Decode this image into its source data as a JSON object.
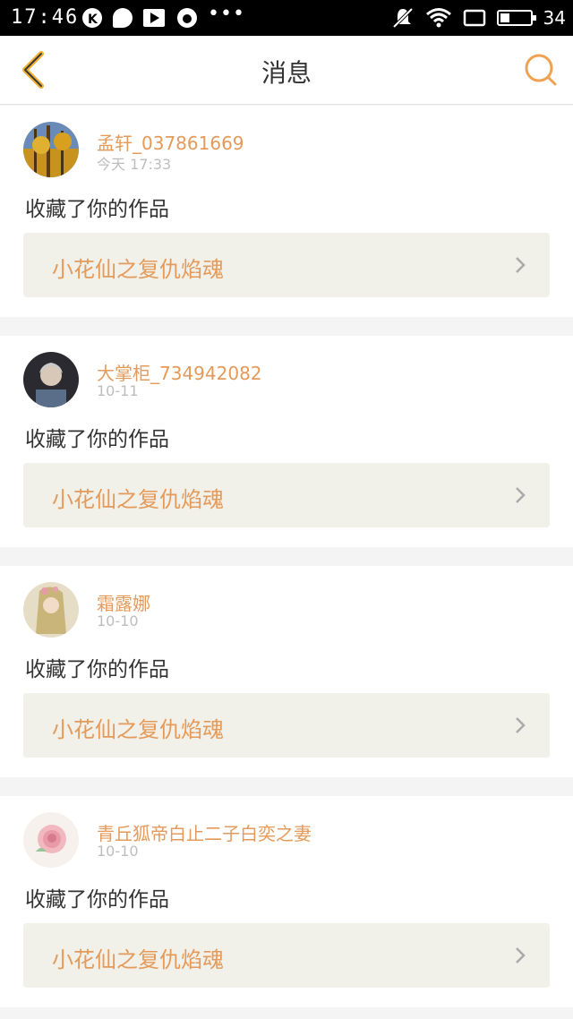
{
  "status_bar": {
    "time": "17:46",
    "battery_level": "34",
    "battery_fraction": 0.34,
    "icons": [
      "k-badge-icon",
      "chat-bubble-icon",
      "video-play-icon",
      "app-icon",
      "more-dots-icon",
      "mute-bell-icon",
      "wifi-icon",
      "screen-rotate-icon",
      "battery-icon"
    ]
  },
  "header": {
    "title": "消息",
    "back_icon": "chevron-left-icon",
    "search_icon": "search-icon",
    "accent_color": "#f0a250"
  },
  "messages": [
    {
      "username": "孟轩_037861669",
      "time": "今天 17:33",
      "action": "收藏了你的作品",
      "work_title": "小花仙之复仇焰魂",
      "avatar": "autumn-forest-avatar"
    },
    {
      "username": "大掌柜_734942082",
      "time": "10-11",
      "action": "收藏了你的作品",
      "work_title": "小花仙之复仇焰魂",
      "avatar": "elderly-woman-avatar"
    },
    {
      "username": "霜露娜",
      "time": "10-10",
      "action": "收藏了你的作品",
      "work_title": "小花仙之复仇焰魂",
      "avatar": "anime-girl-avatar"
    },
    {
      "username": "青丘狐帝白止二子白奕之妻",
      "time": "10-10",
      "action": "收藏了你的作品",
      "work_title": "小花仙之复仇焰魂",
      "avatar": "pink-rose-avatar"
    }
  ],
  "colors": {
    "username": "#e49a5a",
    "work_bg": "#f1f0e9",
    "page_bg": "#f4f4f4"
  }
}
